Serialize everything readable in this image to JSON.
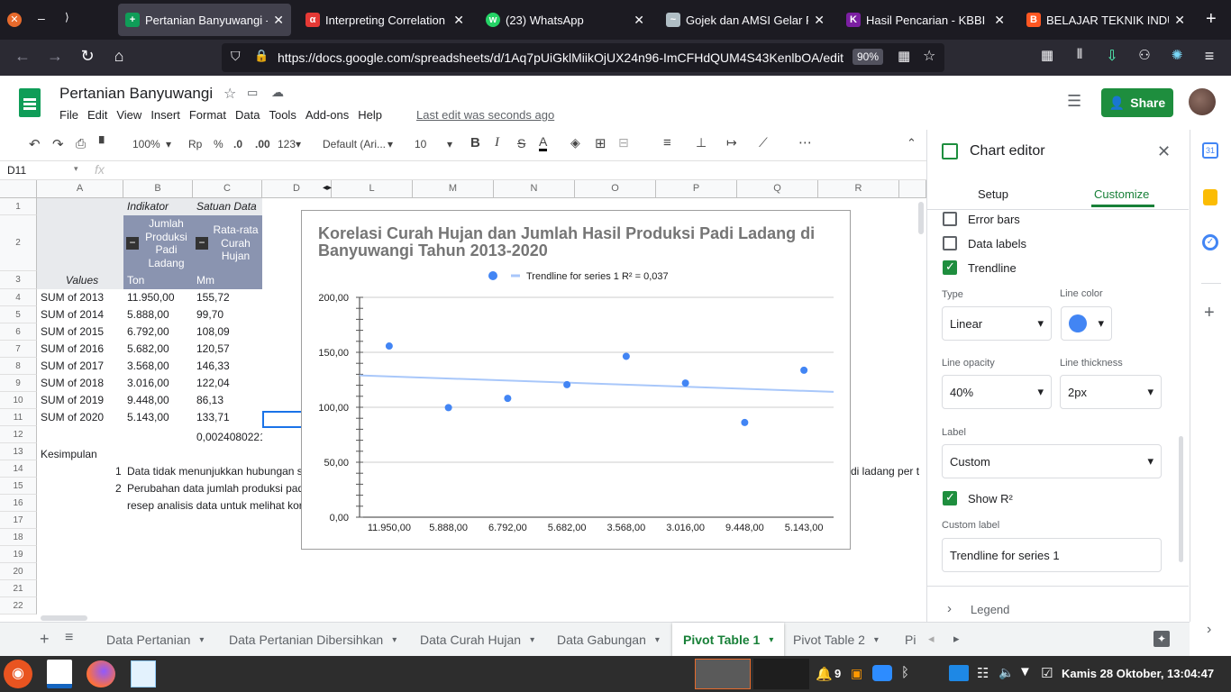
{
  "browser": {
    "tabs": [
      {
        "title": "Pertanian Banyuwangi - ",
        "active": true,
        "icon": "sheets-icon",
        "color": "#0f9d58"
      },
      {
        "title": "Interpreting Correlation ",
        "active": false,
        "icon": "alpha-icon",
        "color": "#e53935"
      },
      {
        "title": "(23) WhatsApp",
        "active": false,
        "icon": "whatsapp-icon",
        "color": "#25d366"
      },
      {
        "title": "Gojek dan AMSI Gelar P",
        "active": false,
        "icon": "gojek-icon",
        "color": "#b0bec5"
      },
      {
        "title": "Hasil Pencarian - KBBI D",
        "active": false,
        "icon": "kbbi-icon",
        "color": "#7b1fa2"
      },
      {
        "title": "BELAJAR TEKNIK INDUS",
        "active": false,
        "icon": "blogger-icon",
        "color": "#ff5722"
      }
    ],
    "url": "https://docs.google.com/spreadsheets/d/1Aq7pUiGklMiikOjUX24n96-ImCFHdQUM4S43KenlbOA/edit",
    "zoom": "90%"
  },
  "doc": {
    "title": "Pertanian Banyuwangi",
    "menus": [
      "File",
      "Edit",
      "View",
      "Insert",
      "Format",
      "Data",
      "Tools",
      "Add-ons",
      "Help"
    ],
    "last_edit": "Last edit was seconds ago",
    "share": "Share"
  },
  "toolbar": {
    "zoom": "100%",
    "currency": "Rp",
    "percent": "%",
    "dec_less": ".0",
    "dec_more": ".00",
    "format_more": "123",
    "font": "Default (Ari...",
    "size": "10"
  },
  "formula": {
    "cell_ref": "D11",
    "fx": "fx",
    "value": ""
  },
  "grid": {
    "columns": [
      "A",
      "B",
      "C",
      "D",
      "L",
      "M",
      "N",
      "O",
      "P",
      "Q",
      "R"
    ],
    "rows": [
      "1",
      "2",
      "3",
      "4",
      "5",
      "6",
      "7",
      "8",
      "9",
      "10",
      "11",
      "12",
      "13",
      "14",
      "15",
      "16",
      "17",
      "18",
      "19",
      "20",
      "21",
      "22"
    ],
    "indikator": "Indikator",
    "satuan_data": "Satuan Data",
    "hdr_b": "Jumlah Produksi Padi Ladang",
    "hdr_c": "Rata-rata Curah Hujan",
    "values_label": "Values",
    "unit_b": "Ton",
    "unit_c": "Mm",
    "data_rows": [
      {
        "label": "SUM of 2013",
        "b": "11.950,00",
        "c": "155,72"
      },
      {
        "label": "SUM of 2014",
        "b": "5.888,00",
        "c": "99,70"
      },
      {
        "label": "SUM of 2015",
        "b": "6.792,00",
        "c": "108,09"
      },
      {
        "label": "SUM of 2016",
        "b": "5.682,00",
        "c": "120,57"
      },
      {
        "label": "SUM of 2017",
        "b": "3.568,00",
        "c": "146,33"
      },
      {
        "label": "SUM of 2018",
        "b": "3.016,00",
        "c": "122,04"
      },
      {
        "label": "SUM of 2019",
        "b": "9.448,00",
        "c": "86,13"
      },
      {
        "label": "SUM of 2020",
        "b": "5.143,00",
        "c": "133,71"
      }
    ],
    "c12": "0,0024080221",
    "kesimpulan": "Kesimpulan",
    "k1_num": "1",
    "k1": "Data tidak menunjukkan hubungan s",
    "k2_num": "2",
    "k2": "Perubahan data jumlah produksi pad",
    "k3": "resep analisis data untuk melihat kor",
    "tail14": "di ladang per t"
  },
  "chart_data": {
    "type": "scatter",
    "title": "Korelasi Curah Hujan dan Jumlah Hasil Produksi Padi Ladang di Banyuwangi Tahun 2013-2020",
    "legend": "Trendline for series 1 R² = 0,037",
    "legend_position": "top",
    "categories": [
      "11.950,00",
      "5.888,00",
      "6.792,00",
      "5.682,00",
      "3.568,00",
      "3.016,00",
      "9.448,00",
      "5.143,00"
    ],
    "values": [
      155.72,
      99.7,
      108.09,
      120.57,
      146.33,
      122.04,
      86.13,
      133.71
    ],
    "y_ticks": [
      "0,00",
      "50,00",
      "100,00",
      "150,00",
      "200,00"
    ],
    "ylim": [
      0,
      200
    ],
    "trendline": {
      "start": 129,
      "end": 114
    },
    "point_color": "#4285f4",
    "trend_color": "#a8c7fa"
  },
  "editor": {
    "title": "Chart editor",
    "tabs": [
      "Setup",
      "Customize"
    ],
    "error_bars": "Error bars",
    "data_labels": "Data labels",
    "trendline": "Trendline",
    "type_label": "Type",
    "type_value": "Linear",
    "line_color_label": "Line color",
    "opacity_label": "Line opacity",
    "opacity_value": "40%",
    "thickness_label": "Line thickness",
    "thickness_value": "2px",
    "label_label": "Label",
    "label_value": "Custom",
    "show_r2": "Show R²",
    "custom_label_label": "Custom label",
    "custom_label_value": "Trendline for series 1",
    "legend": "Legend"
  },
  "sheets": [
    "Data Pertanian",
    "Data Pertanian Dibersihkan",
    "Data Curah Hujan",
    "Data Gabungan",
    "Pivot Table 1",
    "Pivot Table 2",
    "Pi"
  ],
  "active_sheet": "Pivot Table 1",
  "taskbar": {
    "notif_count": "9",
    "clock": "Kamis 28 Oktober, 13:04:47"
  }
}
